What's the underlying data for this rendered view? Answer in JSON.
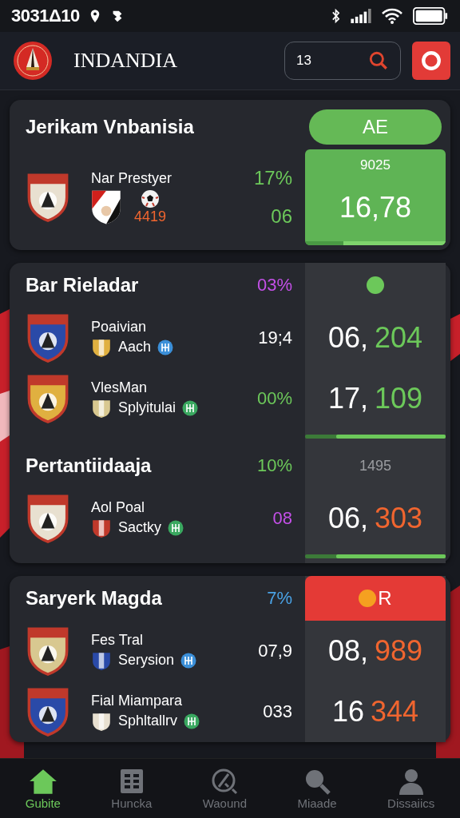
{
  "status_bar": {
    "time": "3031Δ10"
  },
  "header": {
    "title": "INDANDIA",
    "search": {
      "value": "13"
    }
  },
  "cards": [
    {
      "kind": "accent",
      "items": [
        {
          "kind": "title",
          "text": "Jerikam Vnbanisia",
          "panel": {
            "kind": "badge",
            "text": "AE"
          }
        },
        {
          "kind": "feature",
          "name": "Nar Prestyer",
          "score": "4419",
          "stats": [
            {
              "text": "17%",
              "color": "#6cc85a"
            },
            {
              "text": "06",
              "color": "#6cc85a"
            }
          ],
          "panel": {
            "kind": "box",
            "label": "9025",
            "main": "16,78",
            "level": 0.73
          }
        }
      ]
    },
    {
      "kind": "split",
      "items": [
        {
          "kind": "title",
          "text": "Bar Rieladar",
          "percent": {
            "text": "03%",
            "color": "#c450e8"
          },
          "panel": {
            "kind": "dot",
            "color": "#6cc85a"
          }
        },
        {
          "kind": "player",
          "name": "Poaivian",
          "sub": "Aach",
          "stats": [
            {
              "text": "19;4",
              "color": "#ffffff"
            }
          ],
          "panel": {
            "kind": "total",
            "main": "06,",
            "accent": "204",
            "color": "#6cc85a"
          }
        },
        {
          "kind": "player",
          "name": "VlesMan",
          "sub": "Splyitulai",
          "stats": [
            {
              "text": "00%",
              "color": "#6cc85a"
            }
          ],
          "panel": {
            "kind": "total",
            "main": "17,",
            "accent": "109",
            "color": "#6cc85a"
          }
        },
        {
          "kind": "bar",
          "level": 0.78
        },
        {
          "kind": "title",
          "text": "Pertantiidaaja",
          "percent": {
            "text": "10%",
            "color": "#6cc85a"
          },
          "panel": {
            "kind": "label",
            "text": "1495"
          }
        },
        {
          "kind": "player",
          "name": "Aol Poal",
          "sub": "Sactky",
          "stats": [
            {
              "text": "08",
              "color": "#c450e8"
            }
          ],
          "panel": {
            "kind": "total",
            "main": "06,",
            "accent": "303",
            "color": "#f0652f"
          }
        },
        {
          "kind": "bar",
          "level": 0.78
        }
      ]
    },
    {
      "kind": "split",
      "items": [
        {
          "kind": "title",
          "text": "Saryerk Magda",
          "percent": {
            "text": "7%",
            "color": "#4aa3e6"
          },
          "panel": {
            "kind": "alert",
            "text": "R",
            "color": "#f5a020"
          }
        },
        {
          "kind": "player",
          "name": "Fes Tral",
          "sub": "Serysion",
          "stats": [
            {
              "text": "07,9",
              "color": "#ffffff"
            }
          ],
          "panel": {
            "kind": "total",
            "main": "08,",
            "accent": "989",
            "color": "#f0652f"
          }
        },
        {
          "kind": "player",
          "name": "Fial Miampara",
          "sub": "Sphltallrv",
          "stats": [
            {
              "text": "033",
              "color": "#ffffff"
            }
          ],
          "panel": {
            "kind": "total",
            "main": "16",
            "accent": "344",
            "color": "#f0652f"
          }
        }
      ]
    }
  ],
  "nav": [
    {
      "label": "Gubite",
      "selected": true
    },
    {
      "label": "Huncka",
      "selected": false
    },
    {
      "label": "Waound",
      "selected": false
    },
    {
      "label": "Miaade",
      "selected": false
    },
    {
      "label": "Dissaiics",
      "selected": false
    }
  ]
}
